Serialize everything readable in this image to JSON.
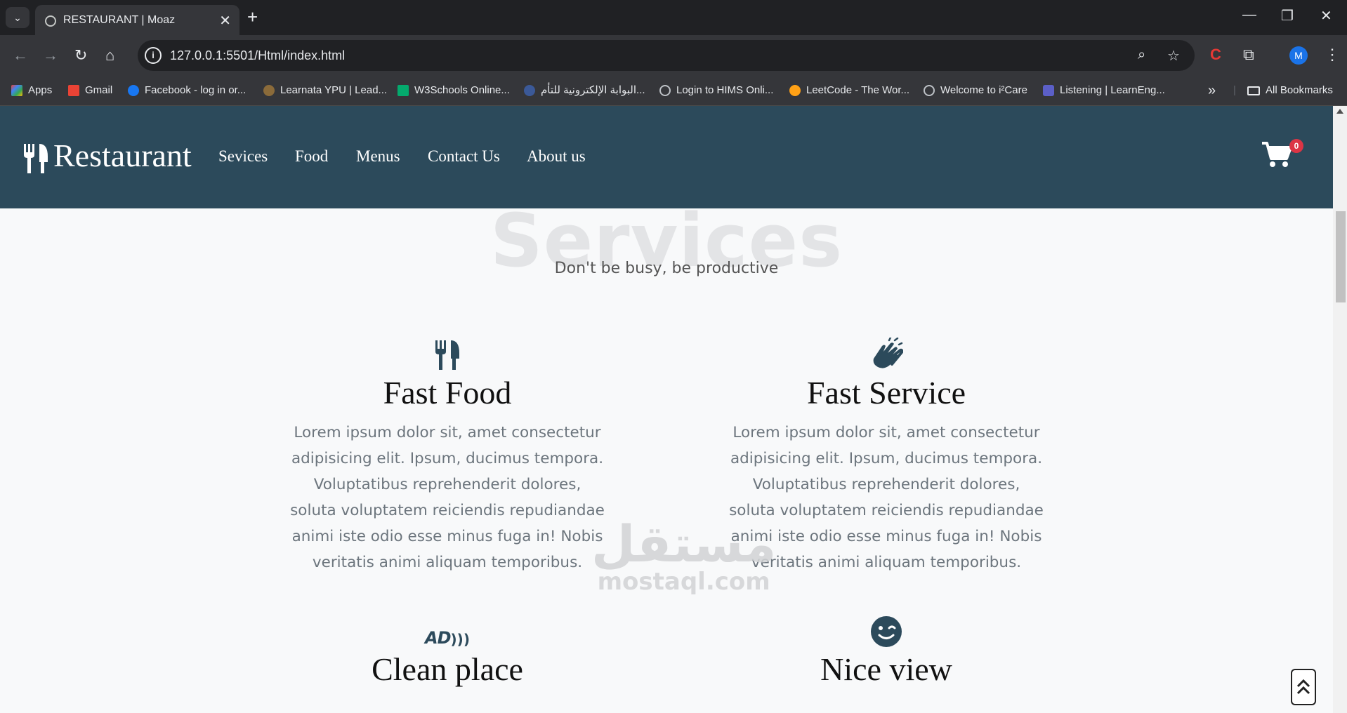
{
  "browser": {
    "tab_title": "RESTAURANT | Moaz",
    "url": "127.0.0.1:5501/Html/index.html",
    "profile_initial": "M",
    "bookmarks": [
      {
        "label": "Apps",
        "color": "#ea4335"
      },
      {
        "label": "Gmail",
        "color": "#ea4335"
      },
      {
        "label": "Facebook - log in or...",
        "color": "#1877f2"
      },
      {
        "label": "Learnata YPU | Lead...",
        "color": "#8b6b3a"
      },
      {
        "label": "W3Schools Online...",
        "color": "#04aa6d"
      },
      {
        "label": "البوابة الإلكترونية للتأم...",
        "color": "#3b5998"
      },
      {
        "label": "Login to HIMS Onli...",
        "color": "#bdc1c6"
      },
      {
        "label": "LeetCode - The Wor...",
        "color": "#ffa116"
      },
      {
        "label": "Welcome to i²Care",
        "color": "#bdc1c6"
      },
      {
        "label": "Listening | LearnEng...",
        "color": "#5b5fc7"
      }
    ],
    "all_bookmarks": "All Bookmarks"
  },
  "site": {
    "brand": "Restaurant",
    "nav": [
      "Sevices",
      "Food",
      "Menus",
      "Contact Us",
      "About us"
    ],
    "cart_count": "0",
    "section_bg_title": "Services",
    "section_subtitle": "Don't be busy, be productive",
    "services": [
      {
        "icon": "utensils-icon",
        "title": "Fast Food",
        "text": "Lorem ipsum dolor sit, amet consectetur adipisicing elit. Ipsum, ducimus tempora. Voluptatibus reprehenderit dolores, soluta voluptatem reiciendis repudiandae animi iste odio esse minus fuga in! Nobis veritatis animi aliquam temporibus."
      },
      {
        "icon": "hands-clapping-icon",
        "title": "Fast Service",
        "text": "Lorem ipsum dolor sit, amet consectetur adipisicing elit. Ipsum, ducimus tempora. Voluptatibus reprehenderit dolores, soluta voluptatem reiciendis repudiandae animi iste odio esse minus fuga in! Nobis veritatis animi aliquam temporibus."
      },
      {
        "icon": "audio-description-icon",
        "title": "Clean place",
        "icon_text": "AD"
      },
      {
        "icon": "smile-wink-icon",
        "title": "Nice view"
      }
    ],
    "watermark": {
      "arabic": "مستقل",
      "latin": "mostaql.com"
    }
  },
  "colors": {
    "navbar": "#2c4a5b",
    "badge": "#dc3545",
    "icon": "#2c4a5b"
  }
}
